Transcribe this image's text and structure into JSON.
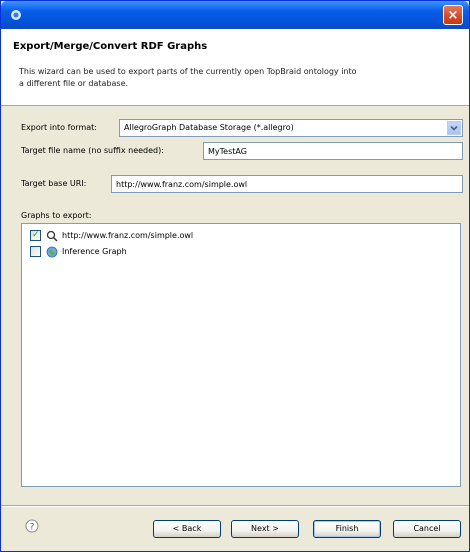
{
  "window": {
    "close_glyph": "×",
    "colors": {
      "titlebar": "#0a5ee8",
      "close": "#d24a28",
      "body": "#ece9d8"
    }
  },
  "header": {
    "title": "Export/Merge/Convert RDF Graphs",
    "description": "This wizard can be used to export parts of the currently open TopBraid ontology into a different file or database."
  },
  "form": {
    "export_format": {
      "label": "Export into format:",
      "value": "AllegroGraph Database Storage (*.allegro)"
    },
    "target_file": {
      "label": "Target file name (no suffix needed):",
      "value": "MyTestAG"
    },
    "target_base_uri": {
      "label": "Target base URI:",
      "value": "http://www.franz.com/simple.owl"
    }
  },
  "graphs": {
    "label": "Graphs to export:",
    "items": [
      {
        "label": "http://www.franz.com/simple.owl",
        "checked": true,
        "icon": "ontology-icon"
      },
      {
        "label": "Inference Graph",
        "checked": false,
        "icon": "globe-icon"
      }
    ]
  },
  "buttons": {
    "back": "< Back",
    "next": "Next >",
    "finish": "Finish",
    "cancel": "Cancel"
  }
}
